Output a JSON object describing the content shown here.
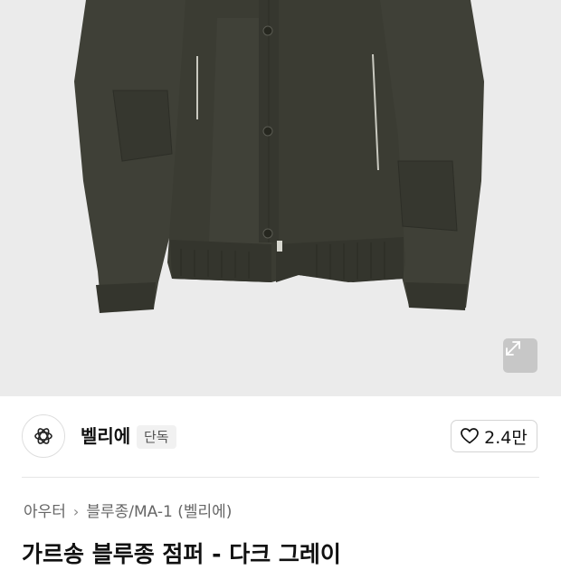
{
  "brand": {
    "name": "벨리에",
    "badge": "단독"
  },
  "like": {
    "count": "2.4만"
  },
  "breadcrumb": {
    "items": [
      "아우터",
      "블루종/MA-1 (벨리에)"
    ]
  },
  "product": {
    "title": "가르송 블루종 점퍼 - 다크 그레이"
  },
  "icons": {
    "expand": "expand-icon",
    "like": "heart-icon",
    "logo": "brand-logo-icon",
    "separator": "chevron-right-icon"
  },
  "colors": {
    "jacket": "#3e3f36",
    "image_background": "#ebebeb"
  }
}
